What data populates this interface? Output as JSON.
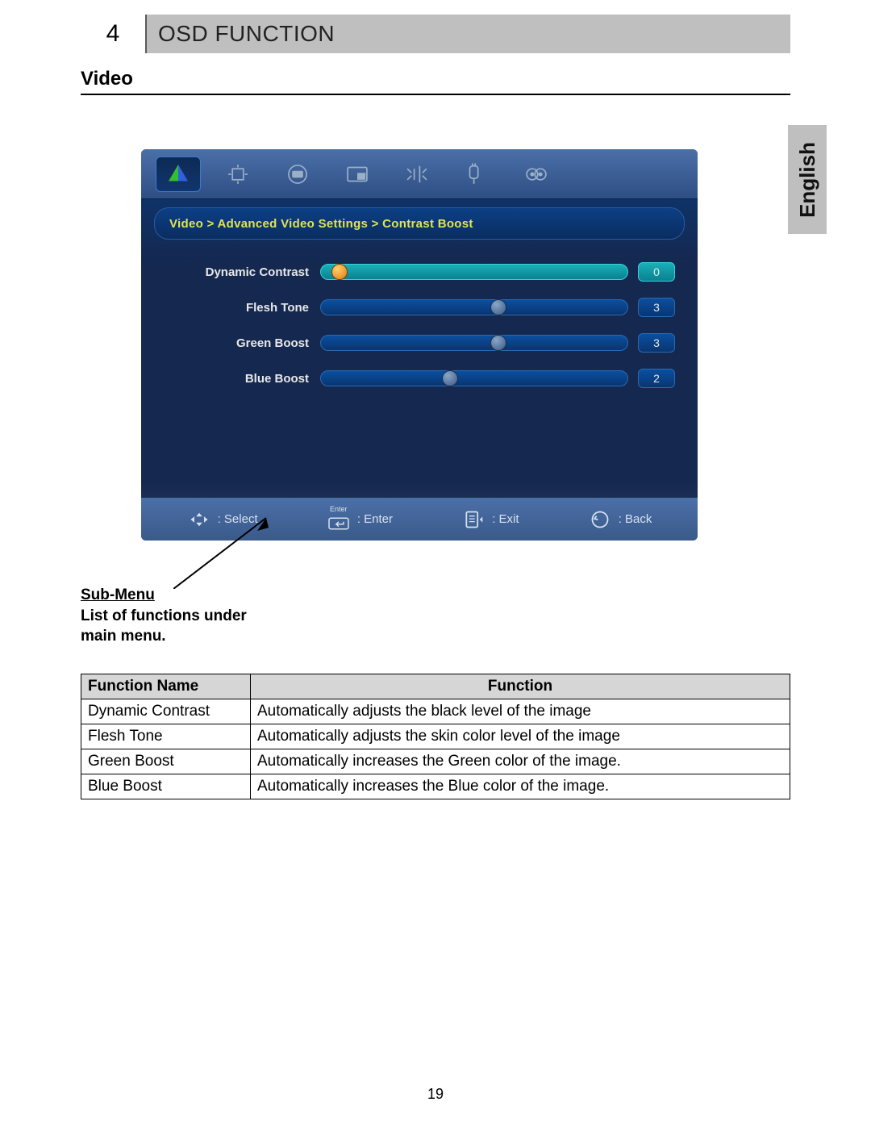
{
  "chapter": {
    "number": "4",
    "title": "OSD FUNCTION"
  },
  "section_heading": "Video",
  "language_tab": "English",
  "osd": {
    "breadcrumb": "Video > Advanced Video Settings > Contrast Boost",
    "sliders": [
      {
        "label": "Dynamic Contrast",
        "value": "0",
        "pos_pct": 6,
        "selected": true,
        "thumb": "orange"
      },
      {
        "label": "Flesh Tone",
        "value": "3",
        "pos_pct": 58,
        "selected": false,
        "thumb": "gray"
      },
      {
        "label": "Green Boost",
        "value": "3",
        "pos_pct": 58,
        "selected": false,
        "thumb": "gray"
      },
      {
        "label": "Blue Boost",
        "value": "2",
        "pos_pct": 42,
        "selected": false,
        "thumb": "gray"
      }
    ],
    "footer": {
      "select": ": Select",
      "enter_small": "Enter",
      "enter": ": Enter",
      "exit": ": Exit",
      "back": ": Back"
    }
  },
  "annotation": {
    "title": "Sub-Menu",
    "line1": "List of functions under",
    "line2": "main menu."
  },
  "table": {
    "head": {
      "name": "Function Name",
      "desc": "Function"
    },
    "rows": [
      {
        "name": "Dynamic Contrast",
        "desc": "Automatically adjusts the black level of the image"
      },
      {
        "name": "Flesh Tone",
        "desc": "Automatically adjusts the skin color level of the image"
      },
      {
        "name": "Green Boost",
        "desc": "Automatically increases the Green color of the image."
      },
      {
        "name": "Blue Boost",
        "desc": "Automatically increases the Blue color of the image."
      }
    ]
  },
  "page_number": "19"
}
